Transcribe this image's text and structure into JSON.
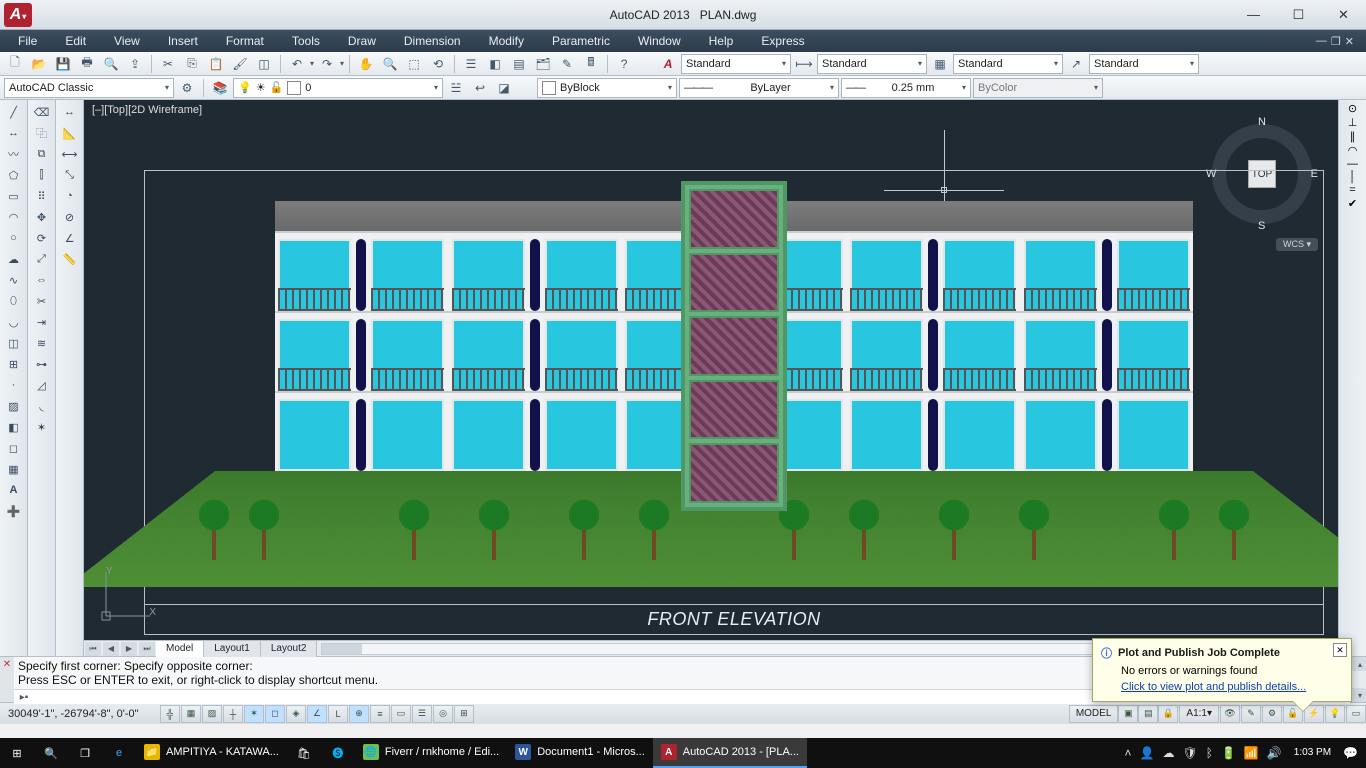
{
  "titlebar": {
    "app": "AutoCAD 2013",
    "file": "PLAN.dwg"
  },
  "menus": [
    "File",
    "Edit",
    "View",
    "Insert",
    "Format",
    "Tools",
    "Draw",
    "Dimension",
    "Modify",
    "Parametric",
    "Window",
    "Help",
    "Express"
  ],
  "row1": {
    "workspace_dd": "AutoCAD Classic",
    "layer_dd": "0",
    "style_dd1": "Standard",
    "style_dd2": "Standard",
    "style_dd3": "Standard",
    "style_dd4": "Standard"
  },
  "row2": {
    "color_dd": "ByBlock",
    "linetype_dd": "ByLayer",
    "lineweight_dd": "0.25 mm",
    "plotstyle_dd": "ByColor"
  },
  "viewport": {
    "label": "[–][Top][2D Wireframe]"
  },
  "viewcube": {
    "face": "TOP",
    "n": "N",
    "s": "S",
    "e": "E",
    "w": "W",
    "wcs": "WCS ▾"
  },
  "ucs": {
    "x": "X",
    "y": "Y"
  },
  "drawing": {
    "title": "FRONT ELEVATION"
  },
  "tabs": {
    "model": "Model",
    "layout1": "Layout1",
    "layout2": "Layout2"
  },
  "command": {
    "line1": "Specify first corner: Specify opposite corner:",
    "line2": "Press ESC or ENTER to exit, or right-click to display shortcut menu.",
    "prompt_icon": "▸▪"
  },
  "status": {
    "coords": "30049'-1\", -26794'-8\", 0'-0\"",
    "model_btn": "MODEL",
    "scale": "1:1",
    "annoscale": "A"
  },
  "notification": {
    "title": "Plot and Publish Job Complete",
    "body": "No errors or warnings found",
    "link": "Click to view plot and publish details..."
  },
  "taskbar": {
    "items": [
      {
        "icon_bg": "#e6b800",
        "icon_txt": "📁",
        "label": "AMPITIYA - KATAWA..."
      },
      {
        "icon_bg": "#1db954",
        "icon_txt": "Fi",
        "label": "Fiverr / rnkhome / Edi..."
      },
      {
        "icon_bg": "#2b579a",
        "icon_txt": "W",
        "label": "Document1 - Micros..."
      },
      {
        "icon_bg": "#b02230",
        "icon_txt": "A",
        "label": "AutoCAD 2013 - [PLA...",
        "active": true
      }
    ],
    "time": "1:03 PM",
    "date": ""
  }
}
